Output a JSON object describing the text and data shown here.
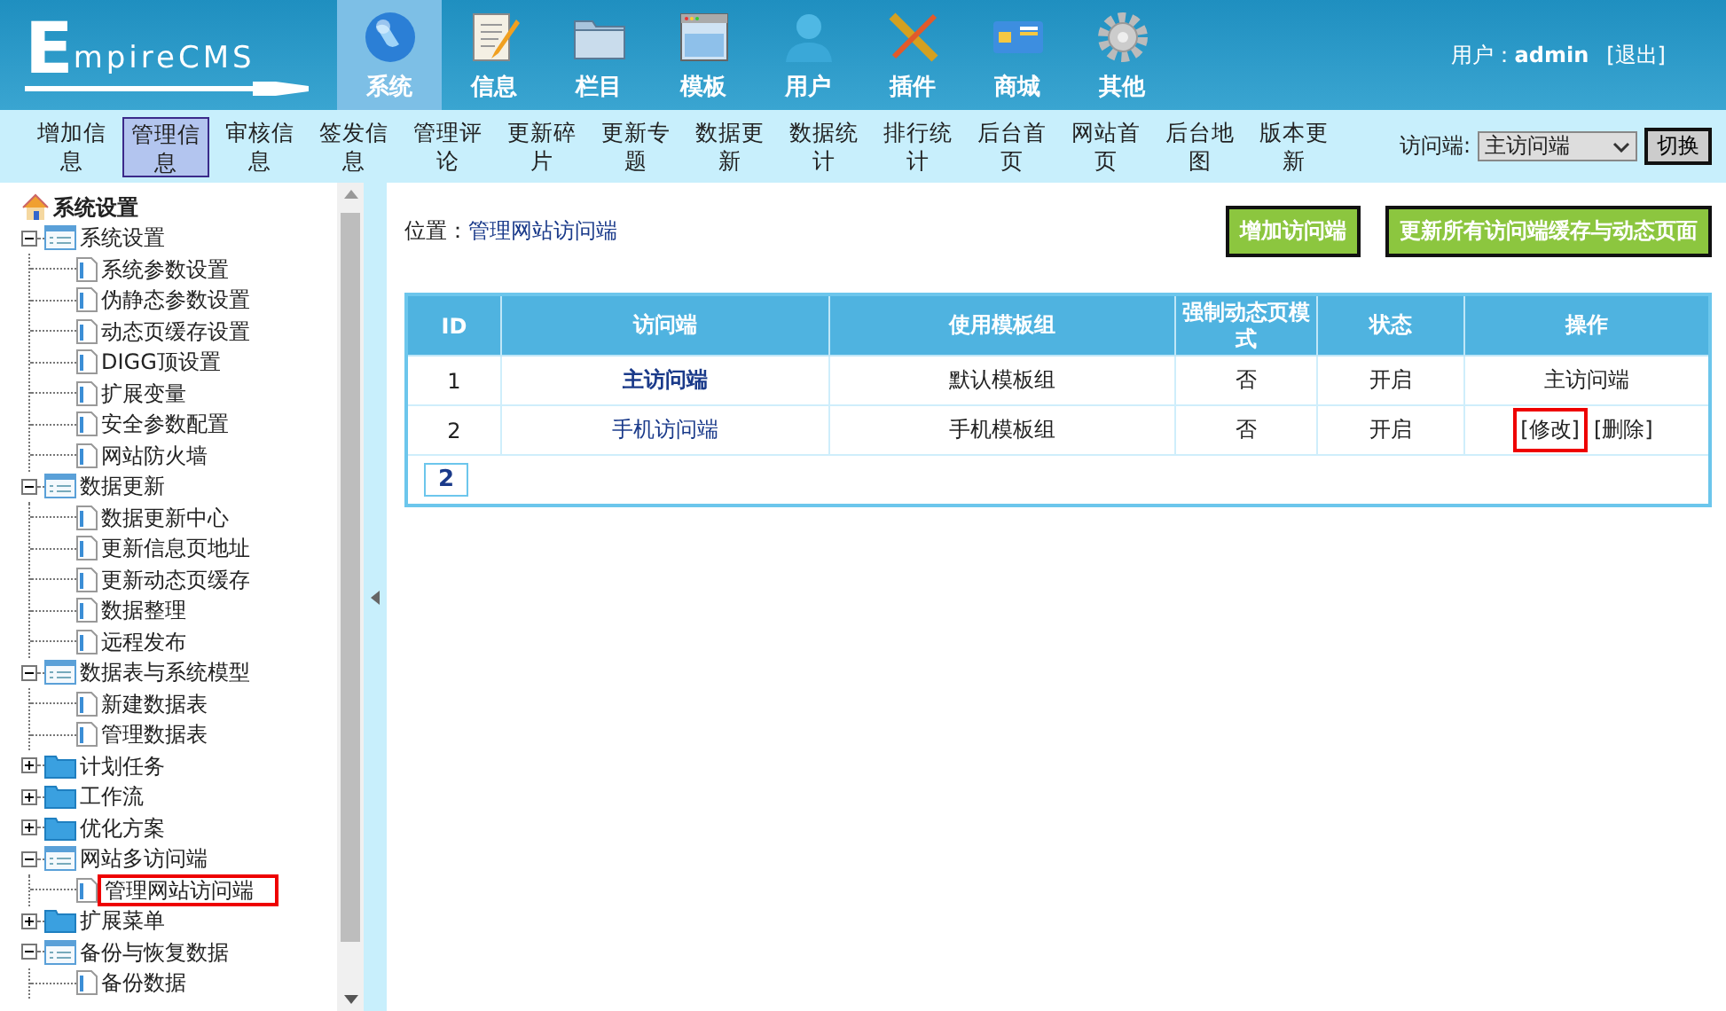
{
  "logo": {
    "text": "mpireCMS",
    "initial": "E"
  },
  "top_nav": [
    {
      "label": "系统",
      "selected": true
    },
    {
      "label": "信息",
      "selected": false
    },
    {
      "label": "栏目",
      "selected": false
    },
    {
      "label": "模板",
      "selected": false
    },
    {
      "label": "用户",
      "selected": false
    },
    {
      "label": "插件",
      "selected": false
    },
    {
      "label": "商城",
      "selected": false
    },
    {
      "label": "其他",
      "selected": false
    }
  ],
  "user": {
    "label": "用户：",
    "name": "admin",
    "logout": "[退出]"
  },
  "sub_nav": [
    {
      "label": "增加信息",
      "selected": false
    },
    {
      "label": "管理信息",
      "selected": true
    },
    {
      "label": "审核信息",
      "selected": false
    },
    {
      "label": "签发信息",
      "selected": false
    },
    {
      "label": "管理评论",
      "selected": false
    },
    {
      "label": "更新碎片",
      "selected": false
    },
    {
      "label": "更新专题",
      "selected": false
    },
    {
      "label": "数据更新",
      "selected": false
    },
    {
      "label": "数据统计",
      "selected": false
    },
    {
      "label": "排行统计",
      "selected": false
    },
    {
      "label": "后台首页",
      "selected": false
    },
    {
      "label": "网站首页",
      "selected": false
    },
    {
      "label": "后台地图",
      "selected": false
    },
    {
      "label": "版本更新",
      "selected": false
    }
  ],
  "terminal_switch": {
    "label": "访问端:",
    "value": "主访问端",
    "button": "切换"
  },
  "sidebar": {
    "title": "系统设置",
    "tree": [
      {
        "label": "系统设置",
        "expanded": true,
        "children": [
          {
            "label": "系统参数设置",
            "selected": false
          },
          {
            "label": "伪静态参数设置",
            "selected": false
          },
          {
            "label": "动态页缓存设置",
            "selected": false
          },
          {
            "label": "DIGG顶设置",
            "selected": false
          },
          {
            "label": "扩展变量",
            "selected": false
          },
          {
            "label": "安全参数配置",
            "selected": false
          },
          {
            "label": "网站防火墙",
            "selected": false
          }
        ]
      },
      {
        "label": "数据更新",
        "expanded": true,
        "children": [
          {
            "label": "数据更新中心",
            "selected": false
          },
          {
            "label": "更新信息页地址",
            "selected": false
          },
          {
            "label": "更新动态页缓存",
            "selected": false
          },
          {
            "label": "数据整理",
            "selected": false
          },
          {
            "label": "远程发布",
            "selected": false
          }
        ]
      },
      {
        "label": "数据表与系统模型",
        "expanded": true,
        "children": [
          {
            "label": "新建数据表",
            "selected": false
          },
          {
            "label": "管理数据表",
            "selected": false
          }
        ]
      },
      {
        "label": "计划任务",
        "expanded": false
      },
      {
        "label": "工作流",
        "expanded": false
      },
      {
        "label": "优化方案",
        "expanded": false
      },
      {
        "label": "网站多访问端",
        "expanded": true,
        "children": [
          {
            "label": "管理网站访问端",
            "selected": true
          }
        ]
      },
      {
        "label": "扩展菜单",
        "expanded": false
      },
      {
        "label": "备份与恢复数据",
        "expanded": true,
        "children": [
          {
            "label": "备份数据",
            "selected": false
          }
        ]
      }
    ]
  },
  "breadcrumb": {
    "label": "位置：",
    "page": "管理网站访问端"
  },
  "actions": [
    "增加访问端",
    "更新所有访问端缓存与动态页面"
  ],
  "table": {
    "columns": [
      "ID",
      "访问端",
      "使用模板组",
      "强制动态页模式",
      "状态",
      "操作"
    ],
    "rows": [
      {
        "id": "1",
        "name": "主访问端",
        "main": true,
        "template": "默认模板组",
        "forced": "否",
        "status": "开启",
        "operation": {
          "kind": "text",
          "text": "主访问端"
        }
      },
      {
        "id": "2",
        "name": "手机访问端",
        "main": false,
        "template": "手机模板组",
        "forced": "否",
        "status": "开启",
        "operation": {
          "kind": "links",
          "links": [
            {
              "label": "[修改]",
              "highlighted": true
            },
            {
              "label": "[删除]",
              "highlighted": false
            }
          ]
        }
      }
    ]
  },
  "pagination": [
    "2"
  ]
}
